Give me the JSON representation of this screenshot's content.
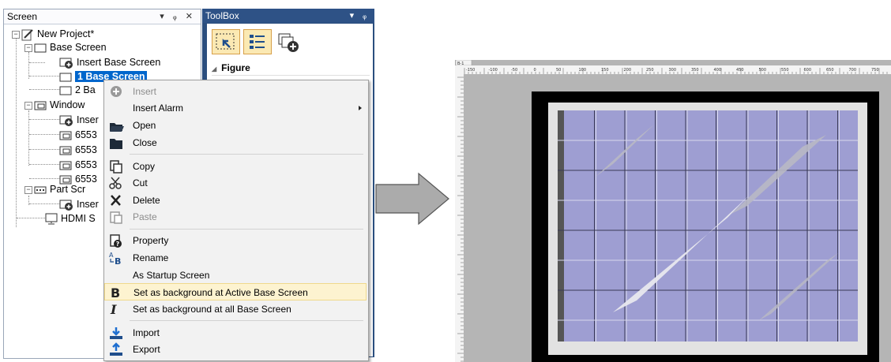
{
  "screen_panel": {
    "title": "Screen",
    "tree": {
      "project": "New Project*",
      "base_screen": "Base Screen",
      "insert_base_screen": "Insert Base Screen",
      "base_screen_1": "1 Base Screen",
      "base_screen_2": "2 Ba",
      "window_screen": "Window",
      "insert_window": "Inser",
      "window_items": [
        "6553",
        "6553",
        "6553",
        "6553"
      ],
      "part_screen": "Part Scr",
      "insert_part": "Inser",
      "hdmi": "HDMI S"
    }
  },
  "toolbox_panel": {
    "title": "ToolBox",
    "section": "Figure"
  },
  "context_menu": {
    "items": [
      {
        "label": "Insert",
        "icon": "add-circle-icon",
        "disabled": true
      },
      {
        "label": "Insert Alarm",
        "icon": "",
        "submenu": true
      },
      {
        "label": "Open",
        "icon": "folder-open-icon"
      },
      {
        "label": "Close",
        "icon": "folder-close-icon"
      },
      {
        "label": "Copy",
        "icon": "copy-icon"
      },
      {
        "label": "Cut",
        "icon": "scissors-icon"
      },
      {
        "label": "Delete",
        "icon": "delete-x-icon"
      },
      {
        "label": "Paste",
        "icon": "paste-icon",
        "disabled": true
      },
      {
        "label": "Property",
        "icon": "property-icon"
      },
      {
        "label": "Rename",
        "icon": "rename-icon"
      },
      {
        "label": "As Startup Screen",
        "icon": ""
      },
      {
        "label": "Set as background at Active Base Screen",
        "icon": "bold-b-icon",
        "highlighted": true
      },
      {
        "label": "Set as background at all Base Screen",
        "icon": "italic-i-icon"
      },
      {
        "label": "Import",
        "icon": "import-icon"
      },
      {
        "label": "Export",
        "icon": "export-icon"
      }
    ]
  },
  "preview": {
    "tab_label": "B-1",
    "ruler_labels": [
      "-150",
      "-100",
      "-50",
      "0",
      "50",
      "100",
      "150",
      "200",
      "250",
      "300",
      "350",
      "400",
      "450",
      "500",
      "550",
      "600",
      "650",
      "700",
      "750"
    ],
    "colors": {
      "canvas": "#9e9ed2",
      "frame": "#e2e2e2",
      "outer": "#000000",
      "grid": "#d8d8ec",
      "background": "#b5b5b5"
    }
  }
}
